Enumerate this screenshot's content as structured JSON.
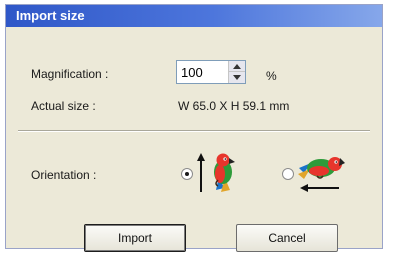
{
  "dialog": {
    "title": "Import size"
  },
  "magnification": {
    "label": "Magnification :",
    "value": "100",
    "unit": "%"
  },
  "actual_size": {
    "label": "Actual size :",
    "value": "W 65.0 X H 59.1 mm"
  },
  "orientation": {
    "label": "Orientation :",
    "options": [
      {
        "icon": "parrot-upright-arrow-icon",
        "selected": true
      },
      {
        "icon": "parrot-rotated-arrow-icon",
        "selected": false
      }
    ]
  },
  "buttons": {
    "import_label": "Import",
    "cancel_label": "Cancel"
  },
  "colors": {
    "title_bar": "#2f57c8",
    "dialog_bg": "#ece9d8"
  }
}
